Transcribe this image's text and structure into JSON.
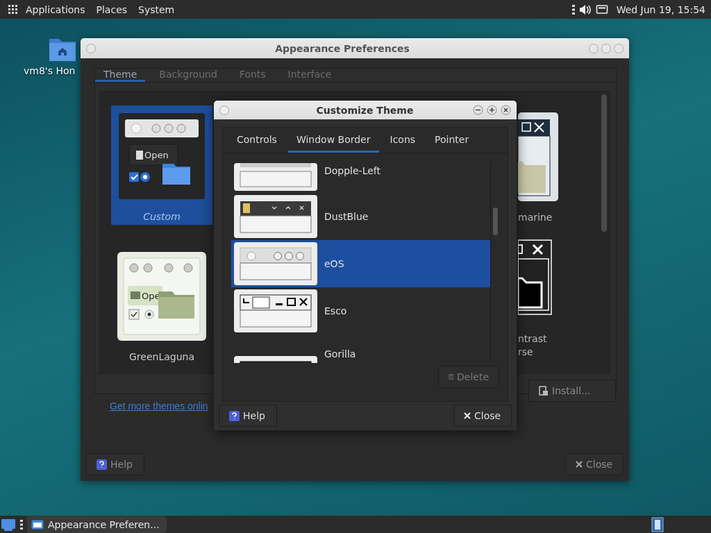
{
  "top_panel": {
    "menus": [
      "Applications",
      "Places",
      "System"
    ],
    "clock": "Wed Jun 19, 15:54"
  },
  "desktop_icons": [
    {
      "label": "vm8's Hon"
    }
  ],
  "appearance_window": {
    "title": "Appearance Preferences",
    "tabs": [
      {
        "label": "Theme",
        "selected": true
      },
      {
        "label": "Background",
        "selected": false
      },
      {
        "label": "Fonts",
        "selected": false
      },
      {
        "label": "Interface",
        "selected": false
      }
    ],
    "themes": [
      {
        "name": "Custom",
        "kind": "custom",
        "selected": true,
        "preview_label": "Open"
      },
      {
        "name": "GreenLaguna",
        "kind": "greenlaguna",
        "selected": false,
        "preview_label": "Ope"
      }
    ],
    "partial_themes": [
      {
        "kind": "marine",
        "name_lines": [
          "marine"
        ]
      },
      {
        "kind": "contrast",
        "name_lines": [
          "ntrast",
          "rse"
        ]
      }
    ],
    "link": "Get more themes onlin",
    "install_button": "Install...",
    "help_button": "Help",
    "close_button": "Close"
  },
  "customize_dialog": {
    "title": "Customize Theme",
    "tabs": [
      {
        "label": "Controls",
        "selected": false
      },
      {
        "label": "Window Border",
        "selected": true
      },
      {
        "label": "Icons",
        "selected": false
      },
      {
        "label": "Pointer",
        "selected": false
      }
    ],
    "borders": [
      {
        "name": "Dopple-Left",
        "kind": "dopple",
        "selected": false
      },
      {
        "name": "DustBlue",
        "kind": "dustblue",
        "selected": false
      },
      {
        "name": "eOS",
        "kind": "eos",
        "selected": true
      },
      {
        "name": "Esco",
        "kind": "esco",
        "selected": false
      },
      {
        "name": "Gorilla",
        "kind": "gorilla",
        "selected": false
      }
    ],
    "delete_button": {
      "label": "Delete",
      "disabled": true
    },
    "help_button": "Help",
    "close_button": "Close"
  },
  "taskbar": {
    "tasks": [
      {
        "label": "Appearance Preferen..."
      }
    ]
  }
}
